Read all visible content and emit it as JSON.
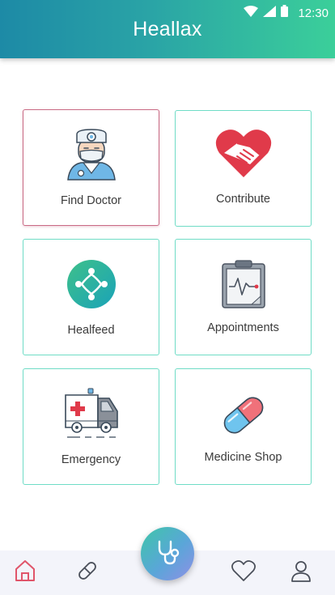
{
  "status_bar": {
    "time": "12:30"
  },
  "app": {
    "title": "Heallax"
  },
  "tiles": [
    {
      "label": "Find Doctor",
      "icon": "doctor-icon",
      "selected": true
    },
    {
      "label": "Contribute",
      "icon": "heart-handshake-icon",
      "selected": false
    },
    {
      "label": "Healfeed",
      "icon": "network-circle-icon",
      "selected": false
    },
    {
      "label": "Appointments",
      "icon": "clipboard-heartbeat-icon",
      "selected": false
    },
    {
      "label": "Emergency",
      "icon": "ambulance-icon",
      "selected": false
    },
    {
      "label": "Medicine Shop",
      "icon": "capsule-icon",
      "selected": false
    }
  ],
  "bottom_nav": {
    "items": [
      "home-icon",
      "pill-icon",
      "stethoscope-icon",
      "heart-icon",
      "profile-icon"
    ],
    "active": "home-icon"
  },
  "colors": {
    "header_start": "#1d8aa6",
    "header_end": "#3bcf9a",
    "tile_border": "#6fdcc6",
    "selected_border": "#c96b85",
    "active_nav": "#e0556a"
  }
}
